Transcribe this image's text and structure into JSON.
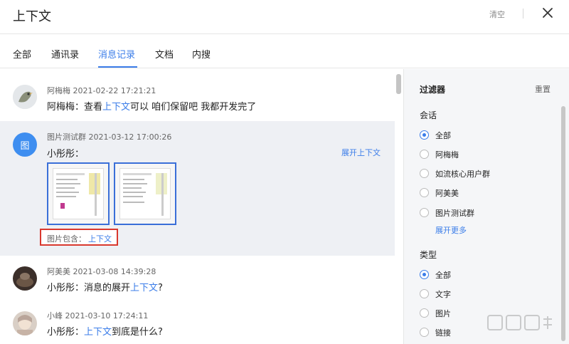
{
  "header": {
    "title": "上下文",
    "clear_label": "清空"
  },
  "tabs": [
    {
      "label": "全部"
    },
    {
      "label": "通讯录"
    },
    {
      "label": "消息记录",
      "active": true
    },
    {
      "label": "文档"
    },
    {
      "label": "内搜"
    }
  ],
  "messages": [
    {
      "sender": "阿梅梅",
      "time": "2021-02-22 17:21:21",
      "text_before": "阿梅梅：查看",
      "keyword": "上下文",
      "text_after": "可以 咱们保留吧 我都开发完了"
    },
    {
      "avatar_text": "图",
      "sender": "图片测试群",
      "time": "2021-03-12 17:00:26",
      "text": "小彤彤：",
      "expand_label": "展开上下文",
      "contains_label": "图片包含：",
      "contains_keyword": "上下文"
    },
    {
      "sender": "阿美美",
      "time": "2021-03-08 14:39:28",
      "text_before": "小彤彤：消息的展开",
      "keyword": "上下文",
      "text_after": "?"
    },
    {
      "sender": "小峰",
      "time": "2021-03-10 17:24:11",
      "text_before": "小彤彤：",
      "keyword": "上下文",
      "text_after": "到底是什么?"
    }
  ],
  "filter": {
    "title": "过滤器",
    "reset_label": "重置",
    "session_label": "会话",
    "session_options": [
      "全部",
      "阿梅梅",
      "如流核心用户群",
      "阿美美",
      "图片测试群"
    ],
    "more_label": "展开更多",
    "type_label": "类型",
    "type_options": [
      "全部",
      "文字",
      "图片",
      "链接"
    ]
  },
  "colors": {
    "accent": "#3b7de9",
    "highlight_border": "#d9382e",
    "thumb_border": "#3a6fd8"
  }
}
